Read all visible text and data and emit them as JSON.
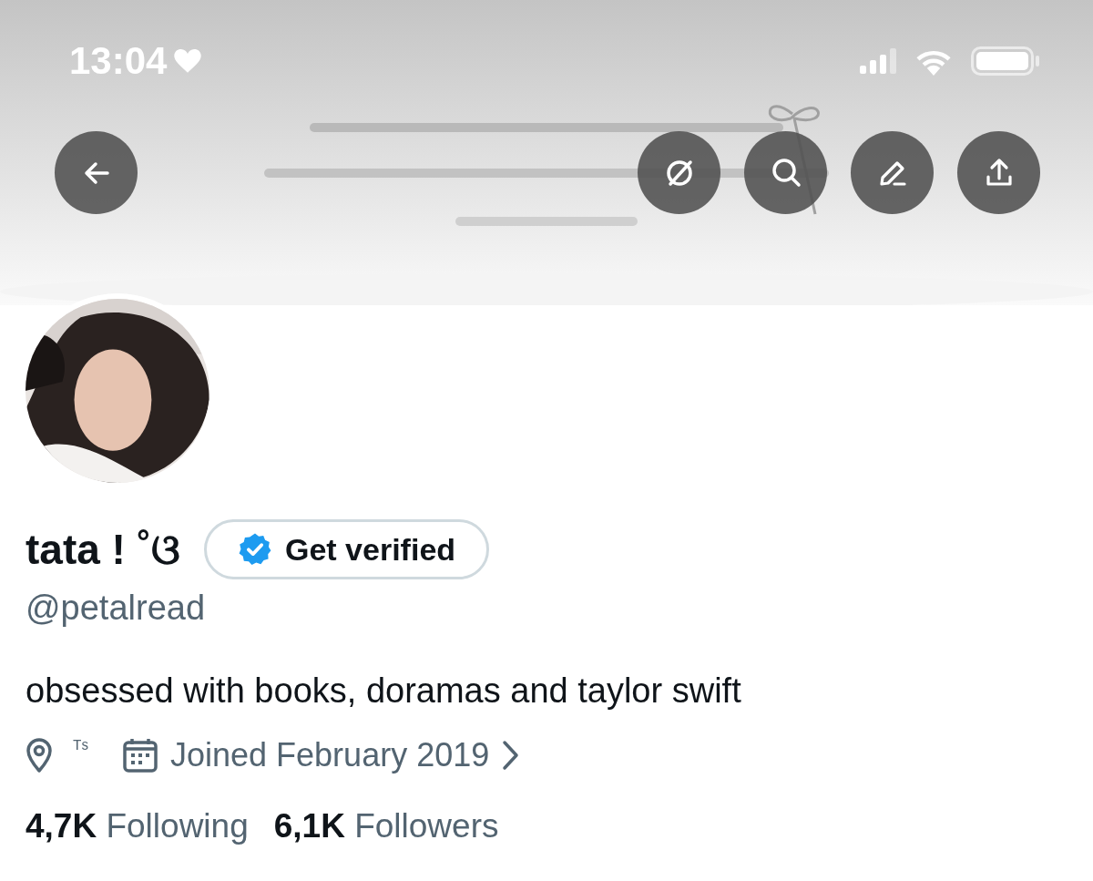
{
  "status_bar": {
    "time": "13:04"
  },
  "profile": {
    "name": "tata ! ˚ଓ",
    "verify_button": "Get verified",
    "handle": "@petalread",
    "bio": "obsessed with books, doramas and taylor swift",
    "location": "ᵀˢ",
    "joined": "Joined February 2019"
  },
  "stats": [
    {
      "count": "4,7K",
      "label": "Following"
    },
    {
      "count": "6,1K",
      "label": "Followers"
    }
  ]
}
